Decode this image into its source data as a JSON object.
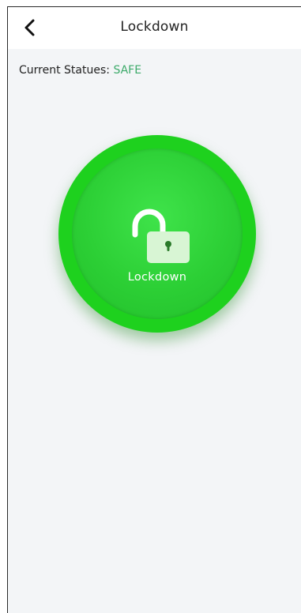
{
  "header": {
    "back_icon": "chevron-left-icon",
    "title": "Lockdown"
  },
  "status": {
    "label": "Current Statues:",
    "value": "SAFE",
    "value_color": "#3daa6a"
  },
  "lockdown_button": {
    "icon": "unlocked-padlock-icon",
    "label": "Lockdown",
    "color": "#1ed11e"
  }
}
